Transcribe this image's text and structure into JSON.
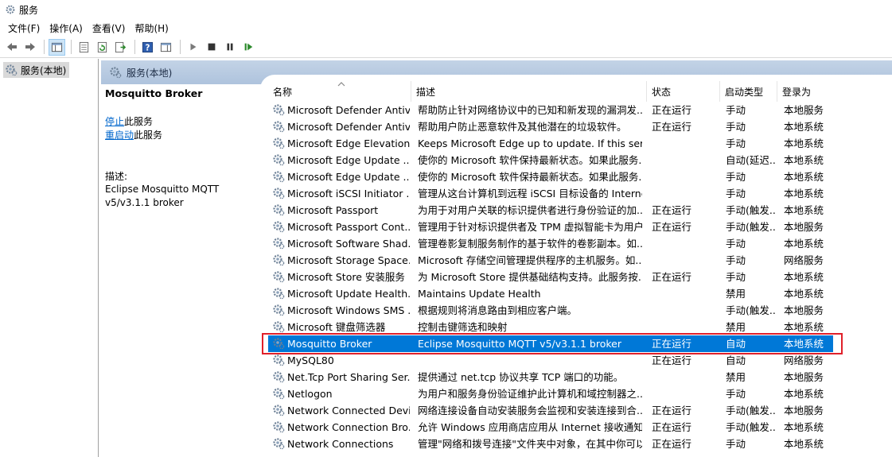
{
  "window": {
    "title": "服务"
  },
  "menu": [
    "文件(F)",
    "操作(A)",
    "查看(V)",
    "帮助(H)"
  ],
  "toolbar": {
    "icons": [
      "back-arrow-icon",
      "forward-arrow-icon",
      "show-hide-tree-icon",
      "properties-icon",
      "refresh-icon",
      "export-list-icon",
      "help-icon",
      "extended-view-icon",
      "start-service-icon",
      "stop-service-icon",
      "pause-service-icon",
      "resume-service-icon"
    ]
  },
  "tree": {
    "item": "服务(本地)"
  },
  "pane_header": {
    "label": "服务(本地)"
  },
  "detail": {
    "service_name": "Mosquitto Broker",
    "stop_link": "停止",
    "stop_suffix": "此服务",
    "restart_link": "重启动",
    "restart_suffix": "此服务",
    "desc_label": "描述:",
    "desc_line1": "Eclipse Mosquitto MQTT",
    "desc_line2": "v5/v3.1.1 broker"
  },
  "columns": {
    "name": "名称",
    "desc": "描述",
    "status": "状态",
    "startup": "启动类型",
    "logon": "登录为"
  },
  "rows": [
    {
      "name": "Microsoft Defender Antiv...",
      "desc": "帮助防止针对网络协议中的已知和新发现的漏洞发...",
      "status": "正在运行",
      "startup": "手动",
      "logon": "本地服务"
    },
    {
      "name": "Microsoft Defender Antiv...",
      "desc": "帮助用户防止恶意软件及其他潜在的垃圾软件。",
      "status": "正在运行",
      "startup": "手动",
      "logon": "本地系统"
    },
    {
      "name": "Microsoft Edge Elevation...",
      "desc": "Keeps Microsoft Edge up to update. If this ser...",
      "status": "",
      "startup": "手动",
      "logon": "本地系统"
    },
    {
      "name": "Microsoft Edge Update ...",
      "desc": "使你的 Microsoft 软件保持最新状态。如果此服务...",
      "status": "",
      "startup": "自动(延迟...",
      "logon": "本地系统"
    },
    {
      "name": "Microsoft Edge Update ...",
      "desc": "使你的 Microsoft 软件保持最新状态。如果此服务...",
      "status": "",
      "startup": "手动",
      "logon": "本地系统"
    },
    {
      "name": "Microsoft iSCSI Initiator ...",
      "desc": "管理从这台计算机到远程 iSCSI 目标设备的 Interne...",
      "status": "",
      "startup": "手动",
      "logon": "本地系统"
    },
    {
      "name": "Microsoft Passport",
      "desc": "为用于对用户关联的标识提供者进行身份验证的加...",
      "status": "正在运行",
      "startup": "手动(触发...",
      "logon": "本地系统"
    },
    {
      "name": "Microsoft Passport Cont...",
      "desc": "管理用于针对标识提供者及 TPM 虚拟智能卡为用户...",
      "status": "正在运行",
      "startup": "手动(触发...",
      "logon": "本地服务"
    },
    {
      "name": "Microsoft Software Shad...",
      "desc": "管理卷影复制服务制作的基于软件的卷影副本。如...",
      "status": "",
      "startup": "手动",
      "logon": "本地系统"
    },
    {
      "name": "Microsoft Storage Space...",
      "desc": "Microsoft 存储空间管理提供程序的主机服务。如...",
      "status": "",
      "startup": "手动",
      "logon": "网络服务"
    },
    {
      "name": "Microsoft Store 安装服务",
      "desc": "为 Microsoft Store 提供基础结构支持。此服务按...",
      "status": "正在运行",
      "startup": "手动",
      "logon": "本地系统"
    },
    {
      "name": "Microsoft Update Health...",
      "desc": "Maintains Update Health",
      "status": "",
      "startup": "禁用",
      "logon": "本地系统"
    },
    {
      "name": "Microsoft Windows SMS ...",
      "desc": "根据规则将消息路由到相应客户端。",
      "status": "",
      "startup": "手动(触发...",
      "logon": "本地服务"
    },
    {
      "name": "Microsoft 键盘筛选器",
      "desc": "控制击键筛选和映射",
      "status": "",
      "startup": "禁用",
      "logon": "本地系统"
    },
    {
      "name": "Mosquitto Broker",
      "desc": "Eclipse Mosquitto MQTT v5/v3.1.1 broker",
      "status": "正在运行",
      "startup": "自动",
      "logon": "本地系统",
      "selected": true
    },
    {
      "name": "MySQL80",
      "desc": "",
      "status": "正在运行",
      "startup": "自动",
      "logon": "网络服务"
    },
    {
      "name": "Net.Tcp Port Sharing Ser...",
      "desc": "提供通过 net.tcp 协议共享 TCP 端口的功能。",
      "status": "",
      "startup": "禁用",
      "logon": "本地服务"
    },
    {
      "name": "Netlogon",
      "desc": "为用户和服务身份验证维护此计算机和域控制器之...",
      "status": "",
      "startup": "手动",
      "logon": "本地系统"
    },
    {
      "name": "Network Connected Devi...",
      "desc": "网络连接设备自动安装服务会监视和安装连接到合...",
      "status": "正在运行",
      "startup": "手动(触发...",
      "logon": "本地服务"
    },
    {
      "name": "Network Connection Bro...",
      "desc": "允许 Windows 应用商店应用从 Internet 接收通知...",
      "status": "正在运行",
      "startup": "手动(触发...",
      "logon": "本地系统"
    },
    {
      "name": "Network Connections",
      "desc": "管理\"网络和拨号连接\"文件夹中对象，在其中你可以...",
      "status": "正在运行",
      "startup": "手动",
      "logon": "本地系统"
    }
  ]
}
